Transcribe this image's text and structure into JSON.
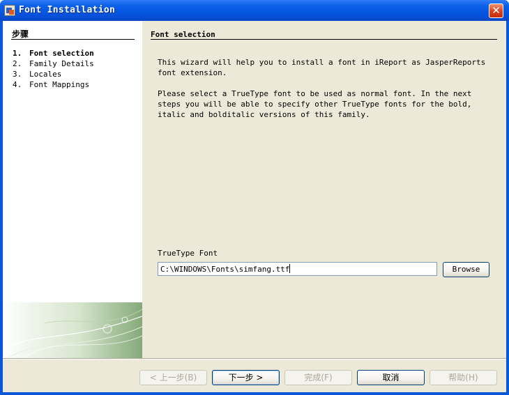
{
  "window": {
    "title": "Font Installation",
    "close_glyph": "✕"
  },
  "sidebar": {
    "title": "步骤",
    "steps": [
      {
        "num": "1.",
        "label": "Font selection",
        "active": true
      },
      {
        "num": "2.",
        "label": "Family Details",
        "active": false
      },
      {
        "num": "3.",
        "label": "Locales",
        "active": false
      },
      {
        "num": "4.",
        "label": "Font Mappings",
        "active": false
      }
    ]
  },
  "content": {
    "section_title": "Font selection",
    "paragraph1": "This wizard will help you to install a font in iReport as JasperReports font extension.",
    "paragraph2": "Please select a TrueType font to be used as normal font. In the next steps you will be able to specify other TrueType fonts for the bold, italic and bolditalic versions of this family.",
    "field_label": "TrueType Font",
    "field_value": "C:\\WINDOWS\\Fonts\\simfang.ttf",
    "browse_label": "Browse"
  },
  "footer": {
    "back_label": "< 上一步(B)",
    "next_label": "下一步 >",
    "finish_label": "完成(F)",
    "cancel_label": "取消",
    "help_label": "帮助(H)"
  },
  "colors": {
    "titlebar": "#0553dd",
    "dialog_bg": "#ece9d8",
    "close_button": "#d8401c"
  },
  "icons": [
    "app-icon",
    "close-icon"
  ]
}
